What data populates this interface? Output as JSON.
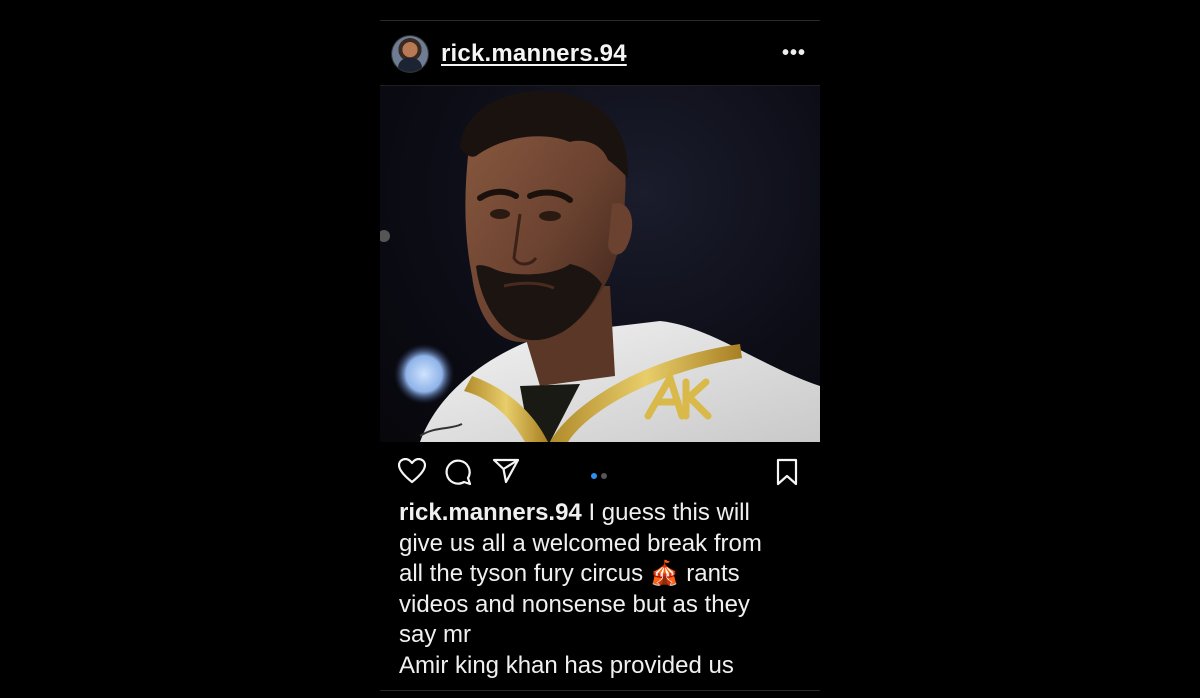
{
  "post": {
    "username": "rick.manners.94",
    "more_label": "•••",
    "image_description_icon": "boxer-photo",
    "carousel": {
      "total": 2,
      "active_index": 0
    },
    "caption": {
      "username": "rick.manners.94",
      "lines": [
        " I guess this will",
        "give us all a welcomed break from",
        "all the tyson fury circus 🎪 rants",
        "videos and nonsense but as they",
        "say mr",
        "Amir king khan  has provided us"
      ]
    }
  },
  "icons": {
    "like": "heart-icon",
    "comment": "comment-icon",
    "share": "send-icon",
    "save": "bookmark-icon",
    "more": "ellipsis-icon"
  },
  "colors": {
    "background": "#000000",
    "text": "#f5f5f5",
    "carousel_active": "#2f8ff0",
    "carousel_inactive": "#555555"
  }
}
